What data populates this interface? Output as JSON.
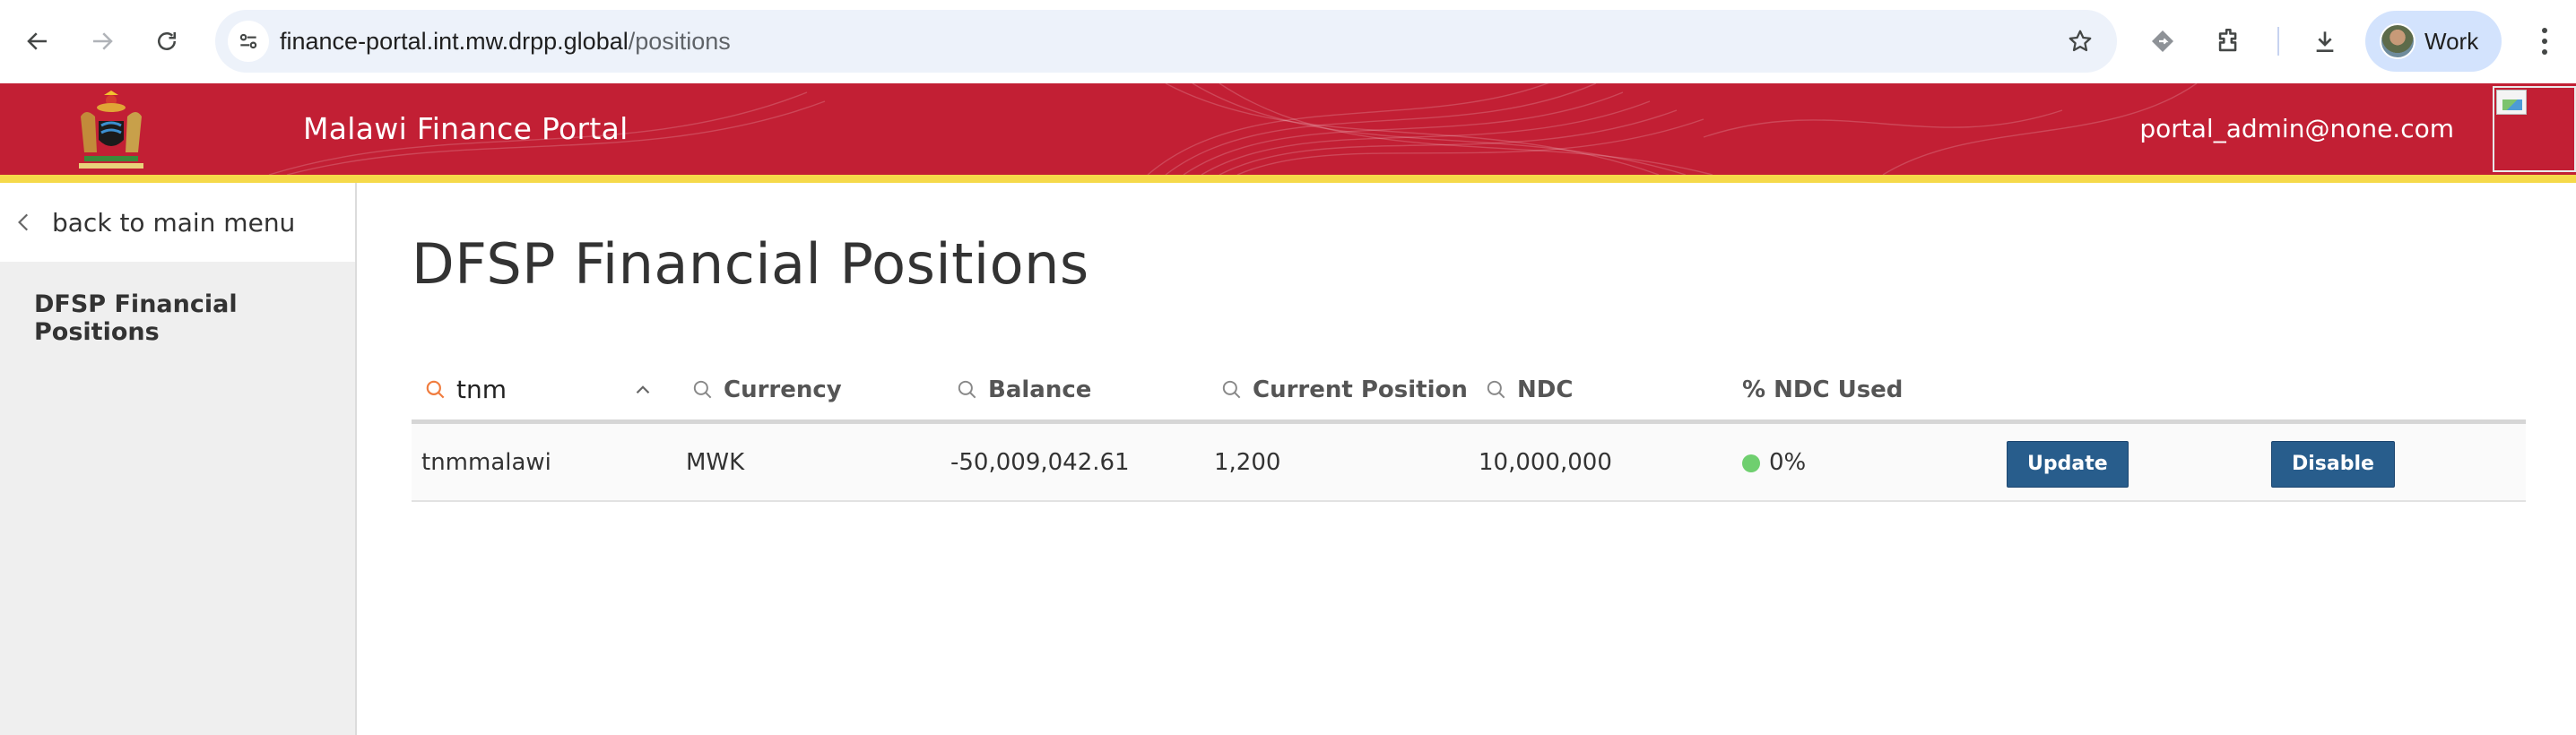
{
  "browser": {
    "url_host": "finance-portal.int.mw.drpp.global",
    "url_path": "/positions",
    "profile_label": "Work"
  },
  "header": {
    "title": "Malawi Finance Portal",
    "user_email": "portal_admin@none.com",
    "brand_color": "#c21f34",
    "stripe_color": "#f5d94a"
  },
  "sidebar": {
    "back_label": "back to main menu",
    "items": [
      {
        "label": "DFSP Financial Positions"
      }
    ]
  },
  "main": {
    "title": "DFSP Financial Positions",
    "search_value": "tnm",
    "columns": {
      "currency": "Currency",
      "balance": "Balance",
      "current_position": "Current Position",
      "ndc": "NDC",
      "ndc_used": "% NDC Used"
    },
    "rows": [
      {
        "dfsp": "tnmmalawi",
        "currency": "MWK",
        "balance": "-50,009,042.61",
        "current_position": "1,200",
        "ndc": "10,000,000",
        "ndc_used": "0%",
        "update_label": "Update",
        "disable_label": "Disable"
      }
    ]
  }
}
